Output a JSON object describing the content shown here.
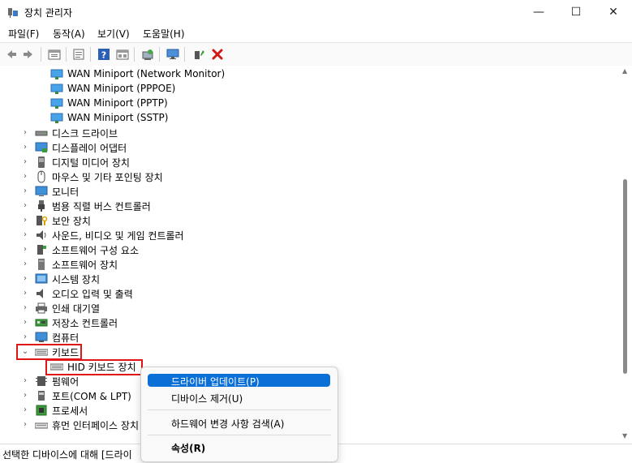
{
  "window": {
    "title": "장치 관리자",
    "controls": [
      "—",
      "☐",
      "✕"
    ]
  },
  "menu": [
    "파일(F)",
    "동작(A)",
    "보기(V)",
    "도움말(H)"
  ],
  "toolbar_icons": [
    "back-arrow-icon",
    "forward-arrow-icon",
    "properties-icon",
    "update-driver-icon",
    "help-icon",
    "view-icon",
    "scan-hardware-icon",
    "monitor-icon",
    "enable-device-icon",
    "uninstall-icon"
  ],
  "tree": {
    "network_children": [
      "WAN Miniport (Network Monitor)",
      "WAN Miniport (PPPOE)",
      "WAN Miniport (PPTP)",
      "WAN Miniport (SSTP)"
    ],
    "categories": [
      "디스크 드라이브",
      "디스플레이 어댑터",
      "디지털 미디어 장치",
      "마우스 및 기타 포인팅 장치",
      "모니터",
      "범용 직렬 버스 컨트롤러",
      "보안 장치",
      "사운드, 비디오 및 게임 컨트롤러",
      "소프트웨어 구성 요소",
      "소프트웨어 장치",
      "시스템 장치",
      "오디오 입력 및 출력",
      "인쇄 대기열",
      "저장소 컨트롤러",
      "컴퓨터",
      "키보드"
    ],
    "keyboard_child": "HID 키보드 장치",
    "after": [
      "펌웨어",
      "포트(COM & LPT)",
      "프로세서",
      "휴먼 인터페이스 장치"
    ]
  },
  "context_menu": {
    "update": "드라이버 업데이트(P)",
    "disable": "디바이스 제거(U)",
    "scan": "하드웨어 변경 사항 검색(A)",
    "props": "속성(R)"
  },
  "status": "선택한 디바이스에 대해 [드라이"
}
